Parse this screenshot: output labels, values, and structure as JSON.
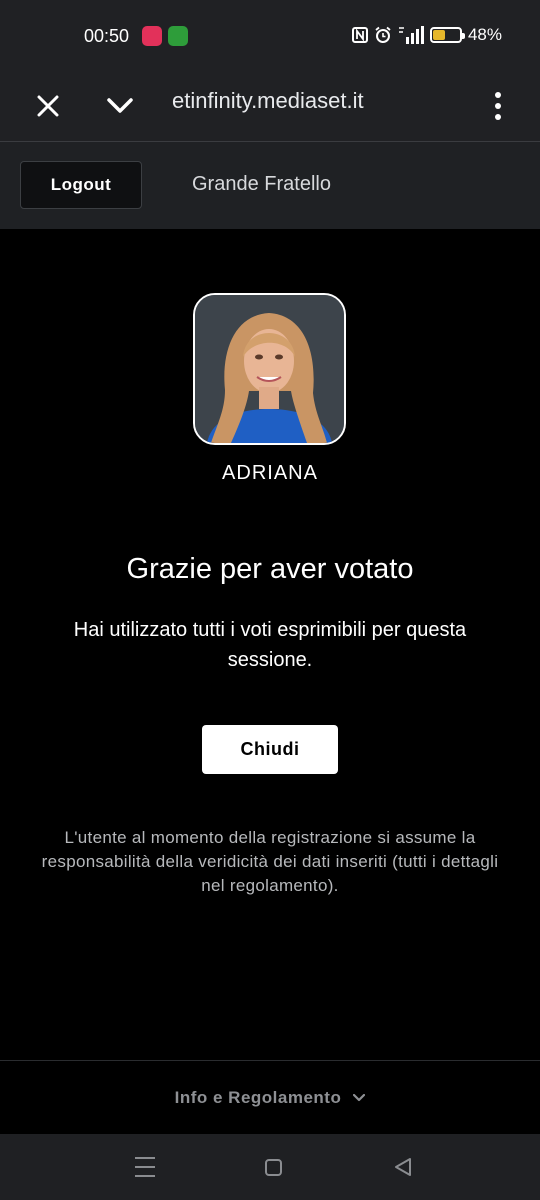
{
  "status_bar": {
    "time": "00:50",
    "battery_percent": "48%",
    "battery_level": 0.48,
    "icons": [
      "shopping-notification-icon",
      "game-notification-icon",
      "nfc-icon",
      "alarm-icon",
      "signal-icon",
      "battery-icon"
    ]
  },
  "browser": {
    "url": "etinfinity.mediaset.it",
    "icons": [
      "close-icon",
      "chevron-down-icon",
      "more-vert-icon"
    ]
  },
  "header": {
    "logout_label": "Logout",
    "title": "Grande Fratello"
  },
  "candidate": {
    "name": "ADRIANA"
  },
  "confirmation": {
    "title": "Grazie per aver votato",
    "message": "Hai utilizzato tutti i voti esprimibili per questa sessione.",
    "close_label": "Chiudi"
  },
  "disclaimer": "L'utente al momento della registrazione si assume la responsabilità della veridicità dei dati inseriti (tutti i dettagli nel regolamento).",
  "footer": {
    "label": "Info e Regolamento"
  },
  "colors": {
    "background": "#000000",
    "bar": "#202124",
    "header": "#1f2124",
    "battery": "#e5b72b",
    "muted_text": "#8e9094"
  }
}
